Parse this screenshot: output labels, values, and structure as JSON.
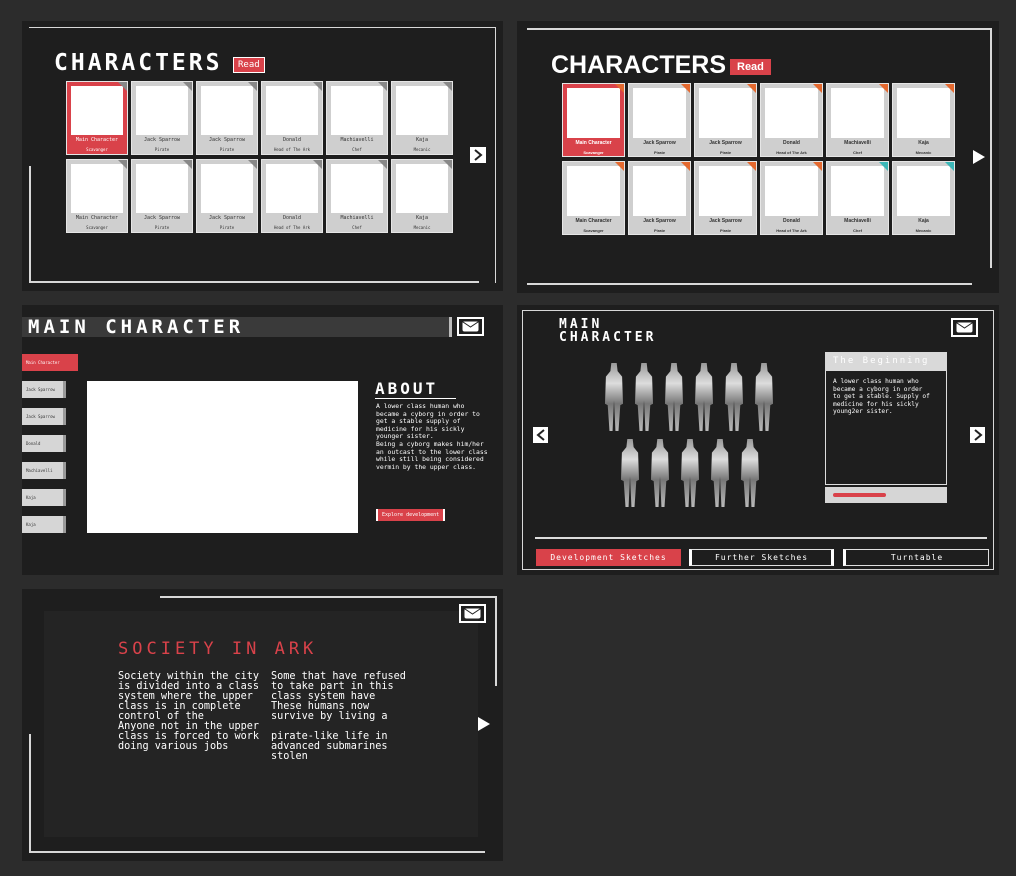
{
  "colors": {
    "accent": "#d9424a",
    "bg": "#1e1e1e",
    "page": "#2c2c2c",
    "card": "#cfcfcf",
    "orange": "#e4692f",
    "teal": "#3bb7b8"
  },
  "panel1": {
    "title": "CHARACTERS",
    "badge": "Read",
    "row1": [
      {
        "name": "Main Character",
        "role": "Scavanger"
      },
      {
        "name": "Jack Sparrow",
        "role": "Pirate"
      },
      {
        "name": "Jack Sparrow",
        "role": "Pirate"
      },
      {
        "name": "Donald",
        "role": "Head of The Ark"
      },
      {
        "name": "Machiavelli",
        "role": "Chef"
      },
      {
        "name": "Kaja",
        "role": "Mecanic"
      }
    ],
    "row2": [
      {
        "name": "Main Character",
        "role": "Scavanger"
      },
      {
        "name": "Jack Sparrow",
        "role": "Pirate"
      },
      {
        "name": "Jack Sparrow",
        "role": "Pirate"
      },
      {
        "name": "Donald",
        "role": "Head of The Ark"
      },
      {
        "name": "Machiavelli",
        "role": "Chef"
      },
      {
        "name": "Kaja",
        "role": "Mecanic"
      }
    ],
    "next_icon": "chevron-right-icon"
  },
  "panel2": {
    "title": "CHARACTERS",
    "badge": "Read",
    "row1": [
      {
        "name": "Main Character",
        "role": "Scavanger"
      },
      {
        "name": "Jack Sparrow",
        "role": "Pirate"
      },
      {
        "name": "Jack Sparrow",
        "role": "Pirate"
      },
      {
        "name": "Donald",
        "role": "Head of The Ark"
      },
      {
        "name": "Machiavelli",
        "role": "Chef"
      },
      {
        "name": "Kaja",
        "role": "Mecanic"
      }
    ],
    "row2": [
      {
        "name": "Main Character",
        "role": "Scavanger"
      },
      {
        "name": "Jack Sparrow",
        "role": "Pirate"
      },
      {
        "name": "Jack Sparrow",
        "role": "Pirate"
      },
      {
        "name": "Donald",
        "role": "Head of The Ark"
      },
      {
        "name": "Machiavelli",
        "role": "Chef"
      },
      {
        "name": "Kaja",
        "role": "Mecanic"
      }
    ],
    "next_icon": "play-right-icon"
  },
  "panel3": {
    "title": "MAIN CHARACTER",
    "nav": [
      "Main Character",
      "Jack Sparrow",
      "Jack Sparrow",
      "Donald",
      "Machiavelli",
      "Kaja",
      "Kaja"
    ],
    "about_heading": "ABOUT",
    "about_text": "A lower class human who became a cyborg in order to get a stable supply of medicine for his sickly younger sister.\nBeing a cyborg makes him/her an outcast to the lower class while still being considered vermin by the upper class.",
    "explore_label": "Explore development"
  },
  "panel4": {
    "title_line1": "MAIN",
    "title_line2": "CHARACTER",
    "box_heading": "The Beginning",
    "box_text": "A lower class human who became a cyborg in order to get a stable. Supply of medicine for his sickly young2er sister.",
    "tabs": [
      "Development Sketches",
      "Further Sketches",
      "Turntable"
    ]
  },
  "panel5": {
    "title": "SOCIETY IN ARK",
    "col1": "Society within the city is divided into a class system where the upper class is in complete control of the\nAnyone not in the upper class is forced to work doing various jobs",
    "col2": "Some that have refused to take part in this class system have\nThese humans now survive by living a\n\npirate-like life in advanced submarines stolen"
  }
}
